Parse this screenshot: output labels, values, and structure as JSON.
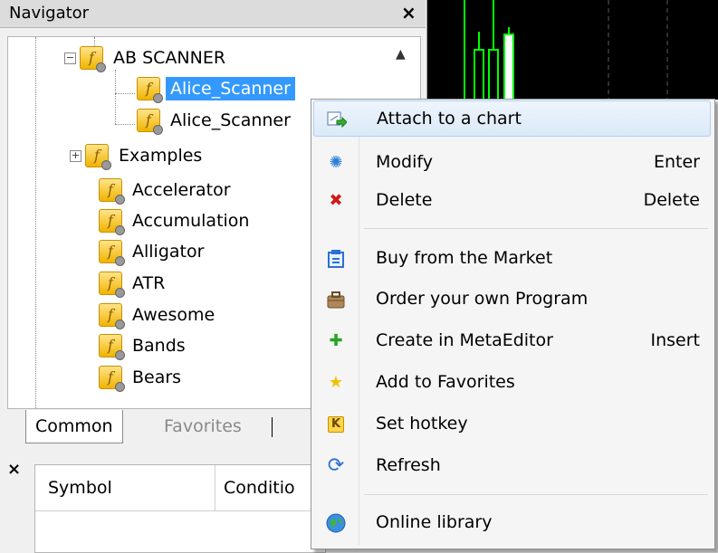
{
  "navigator": {
    "title": "Navigator",
    "close": "×",
    "tree": {
      "folder": "AB SCANNER",
      "children": [
        "Alice_Scanner",
        "Alice_Scanner"
      ],
      "items": [
        "Examples",
        "Accelerator",
        "Accumulation",
        "Alligator",
        "ATR",
        "Awesome",
        "Bands",
        "Bears"
      ]
    },
    "expand_minus": "−",
    "expand_plus": "+",
    "fx_glyph": "f",
    "scroll_up": "▲",
    "tabs": [
      "Common",
      "Favorites"
    ]
  },
  "bottom_panel": {
    "close": "×",
    "columns": [
      "Symbol",
      "Conditio"
    ]
  },
  "context_menu": {
    "items": [
      {
        "label": "Attach to a chart",
        "shortcut": "",
        "icon": "attach-chart-icon"
      },
      {
        "label": "Modify",
        "shortcut": "Enter",
        "icon": "gear-icon"
      },
      {
        "label": "Delete",
        "shortcut": "Delete",
        "icon": "delete-x-icon"
      },
      {
        "label": "Buy from the Market",
        "shortcut": "",
        "icon": "market-icon"
      },
      {
        "label": "Order your own Program",
        "shortcut": "",
        "icon": "briefcase-icon"
      },
      {
        "label": "Create in MetaEditor",
        "shortcut": "Insert",
        "icon": "plus-icon"
      },
      {
        "label": "Add to Favorites",
        "shortcut": "",
        "icon": "star-icon"
      },
      {
        "label": "Set hotkey",
        "shortcut": "",
        "icon": "hotkey-icon"
      },
      {
        "label": "Refresh",
        "shortcut": "",
        "icon": "refresh-icon"
      },
      {
        "label": "Online library",
        "shortcut": "",
        "icon": "globe-icon"
      }
    ],
    "icon_glyphs": {
      "gear": "✺",
      "delete": "✖",
      "plus": "✚",
      "star": "★",
      "hotkey": "K",
      "refresh": "⟳"
    }
  },
  "colors": {
    "selection": "#3399ff",
    "chart_bg": "#000000",
    "candle": "#00ff00",
    "menu_highlight": "#dbe9f8"
  }
}
